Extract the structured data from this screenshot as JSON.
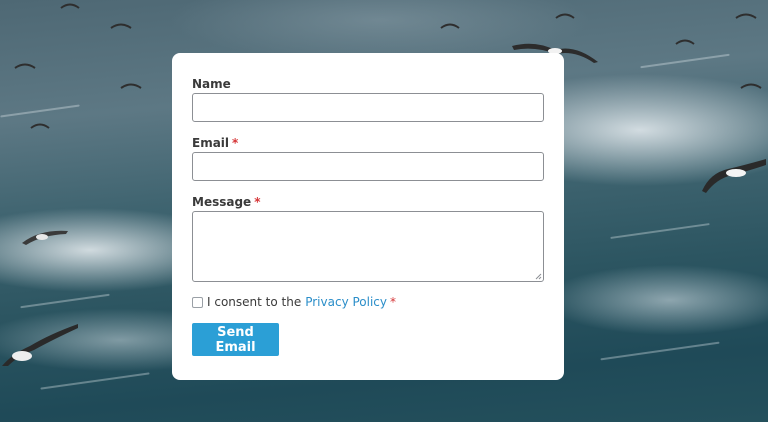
{
  "form": {
    "name_label": "Name",
    "email_label": "Email",
    "message_label": "Message",
    "required_mark": "*",
    "name_value": "",
    "email_value": "",
    "message_value": "",
    "consent_text": "I consent to the",
    "consent_link": "Privacy Policy",
    "consent_checked": false,
    "submit_label": "Send Email"
  },
  "colors": {
    "accent": "#2b9fd6",
    "link": "#2b8ec9",
    "required": "#d63638"
  }
}
